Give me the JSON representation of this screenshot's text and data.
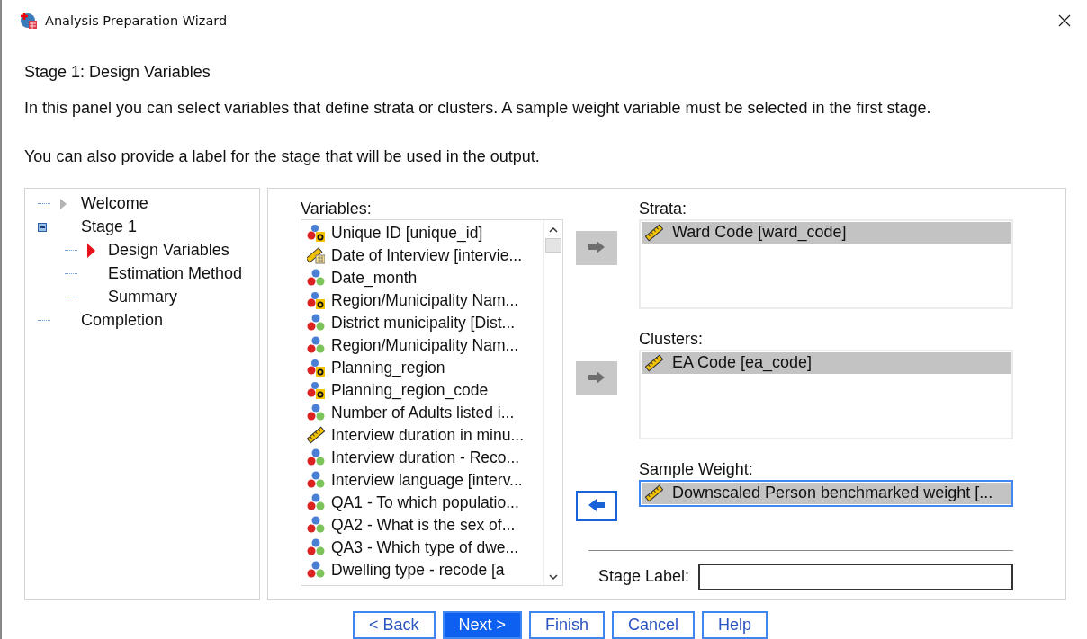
{
  "window": {
    "title": "Analysis Preparation Wizard"
  },
  "heading": "Stage 1: Design Variables",
  "intro": [
    "In this panel you can select variables that define strata or clusters. A sample weight variable must be selected in the first stage.",
    "You can also provide a label for the stage that will be used in the output."
  ],
  "tree": [
    {
      "label": "Welcome",
      "kind": "visited"
    },
    {
      "label": "Stage 1",
      "kind": "plain",
      "expanded": true,
      "children": [
        {
          "label": "Design Variables",
          "kind": "current"
        },
        {
          "label": "Estimation Method",
          "kind": "plain"
        },
        {
          "label": "Summary",
          "kind": "plain"
        }
      ]
    },
    {
      "label": "Completion",
      "kind": "plain"
    }
  ],
  "variables": {
    "label": "Variables:",
    "items": [
      {
        "kind": "string",
        "text": "Unique ID [unique_id]"
      },
      {
        "kind": "date",
        "text": "Date of Interview [intervie..."
      },
      {
        "kind": "nominal",
        "text": "Date_month"
      },
      {
        "kind": "string",
        "text": "Region/Municipality Nam..."
      },
      {
        "kind": "nominal",
        "text": "District municipality [Dist..."
      },
      {
        "kind": "nominal",
        "text": "Region/Municipality Nam..."
      },
      {
        "kind": "string",
        "text": "Planning_region"
      },
      {
        "kind": "string",
        "text": "Planning_region_code"
      },
      {
        "kind": "nominal",
        "text": "Number of Adults listed i..."
      },
      {
        "kind": "scale",
        "text": "Interview duration in minu..."
      },
      {
        "kind": "nominal",
        "text": "Interview duration - Reco..."
      },
      {
        "kind": "nominal",
        "text": "Interview language [interv..."
      },
      {
        "kind": "nominal",
        "text": "QA1 - To which populatio..."
      },
      {
        "kind": "nominal",
        "text": "QA2 - What is the sex of..."
      },
      {
        "kind": "nominal",
        "text": "QA3 - Which type of dwe..."
      },
      {
        "kind": "nominal",
        "text": "Dwelling type - recode [a"
      }
    ]
  },
  "targets": [
    {
      "label": "Strata:",
      "kind": "list",
      "move": {
        "kind": "add",
        "disabled": true
      },
      "items": [
        {
          "kind": "scale",
          "text": "Ward Code [ward_code]"
        }
      ]
    },
    {
      "label": "Clusters:",
      "kind": "list",
      "move": {
        "kind": "add",
        "disabled": true
      },
      "items": [
        {
          "kind": "scale",
          "text": "EA Code [ea_code]"
        }
      ]
    },
    {
      "label": "Sample Weight:",
      "kind": "single",
      "focused": true,
      "move": {
        "kind": "remove",
        "disabled": false
      },
      "items": [
        {
          "kind": "scale",
          "text": "Downscaled Person benchmarked weight [..."
        }
      ]
    }
  ],
  "stage_label": {
    "label": "Stage Label:"
  },
  "buttons": [
    {
      "label": "< Back",
      "default": false
    },
    {
      "label": "Next >",
      "default": true
    },
    {
      "label": "Finish",
      "default": false
    },
    {
      "label": "Cancel",
      "default": false
    },
    {
      "label": "Help",
      "default": false
    }
  ]
}
